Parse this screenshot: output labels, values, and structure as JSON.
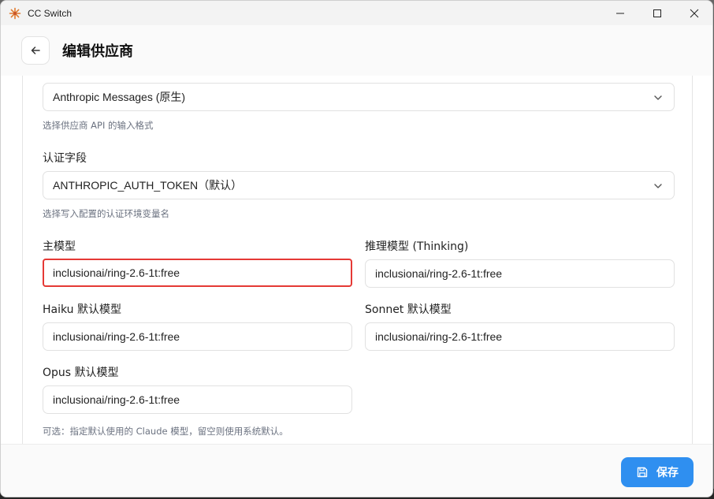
{
  "window": {
    "title": "CC Switch"
  },
  "header": {
    "title": "编辑供应商"
  },
  "api_format": {
    "value": "Anthropic Messages (原生)",
    "hint": "选择供应商 API 的输入格式"
  },
  "auth_field": {
    "label": "认证字段",
    "value": "ANTHROPIC_AUTH_TOKEN（默认）",
    "hint": "选择写入配置的认证环境变量名"
  },
  "models": {
    "main": {
      "label": "主模型",
      "value": "inclusionai/ring-2.6-1t:free"
    },
    "thinking": {
      "label": "推理模型 (Thinking)",
      "value": "inclusionai/ring-2.6-1t:free"
    },
    "haiku": {
      "label": "Haiku 默认模型",
      "value": "inclusionai/ring-2.6-1t:free"
    },
    "sonnet": {
      "label": "Sonnet 默认模型",
      "value": "inclusionai/ring-2.6-1t:free"
    },
    "opus": {
      "label": "Opus 默认模型",
      "value": "inclusionai/ring-2.6-1t:free"
    },
    "hint": "可选：指定默认使用的 Claude 模型，留空则使用系统默认。"
  },
  "footer": {
    "save_label": "保存"
  },
  "colors": {
    "accent": "#2f8ff0",
    "highlight": "#e53935"
  },
  "icons": {
    "logo": "cc-switch-logo-icon",
    "back": "arrow-left-icon",
    "chevron": "chevron-down-icon",
    "save": "save-icon"
  }
}
